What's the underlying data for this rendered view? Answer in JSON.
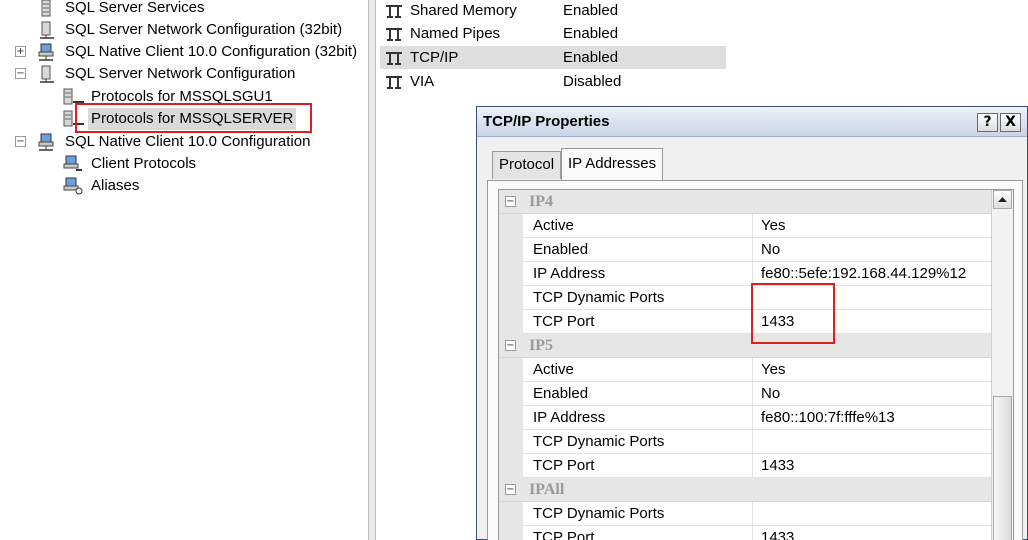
{
  "tree": {
    "items": [
      {
        "label": "SQL Server Services"
      },
      {
        "label": "SQL Server Network Configuration (32bit)"
      },
      {
        "label": "SQL Native Client 10.0 Configuration (32bit)",
        "expander": "+"
      },
      {
        "label": "SQL Server Network Configuration",
        "expander": "−"
      },
      {
        "label": "Protocols for MSSQLSGU1"
      },
      {
        "label": "Protocols for MSSQLSERVER",
        "selected": true
      },
      {
        "label": "SQL Native Client 10.0 Configuration",
        "expander": "−"
      },
      {
        "label": "Client Protocols"
      },
      {
        "label": "Aliases"
      }
    ]
  },
  "protocols": {
    "rows": [
      {
        "name": "Shared Memory",
        "status": "Enabled",
        "icon": "protocol-icon"
      },
      {
        "name": "Named Pipes",
        "status": "Enabled",
        "icon": "protocol-icon"
      },
      {
        "name": "TCP/IP",
        "status": "Enabled",
        "icon": "protocol-icon",
        "selected": true
      },
      {
        "name": "VIA",
        "status": "Disabled",
        "icon": "protocol-icon"
      }
    ]
  },
  "dialog": {
    "title": "TCP/IP Properties",
    "help_label": "?",
    "close_label": "X",
    "tabs": [
      {
        "label": "Protocol"
      },
      {
        "label": "IP Addresses",
        "active": true
      }
    ],
    "grid": {
      "ip4": {
        "category": "IP4",
        "expander": "−",
        "rows": [
          {
            "name": "Active",
            "value": "Yes"
          },
          {
            "name": "Enabled",
            "value": "No"
          },
          {
            "name": "IP Address",
            "value": "fe80::5efe:192.168.44.129%12"
          },
          {
            "name": "TCP Dynamic Ports",
            "value": ""
          },
          {
            "name": "TCP Port",
            "value": "1433"
          }
        ]
      },
      "ip5": {
        "category": "IP5",
        "expander": "−",
        "rows": [
          {
            "name": "Active",
            "value": "Yes"
          },
          {
            "name": "Enabled",
            "value": "No"
          },
          {
            "name": "IP Address",
            "value": "fe80::100:7f:fffe%13"
          },
          {
            "name": "TCP Dynamic Ports",
            "value": ""
          },
          {
            "name": "TCP Port",
            "value": "1433"
          }
        ]
      },
      "ipall": {
        "category": "IPAll",
        "expander": "−",
        "rows": [
          {
            "name": "TCP Dynamic Ports",
            "value": ""
          },
          {
            "name": "TCP Port",
            "value": "1433"
          }
        ]
      }
    }
  },
  "colors": {
    "highlight_box": "#e02020",
    "selection": "#d9d9d9",
    "category_text": "#9a9a9a"
  }
}
